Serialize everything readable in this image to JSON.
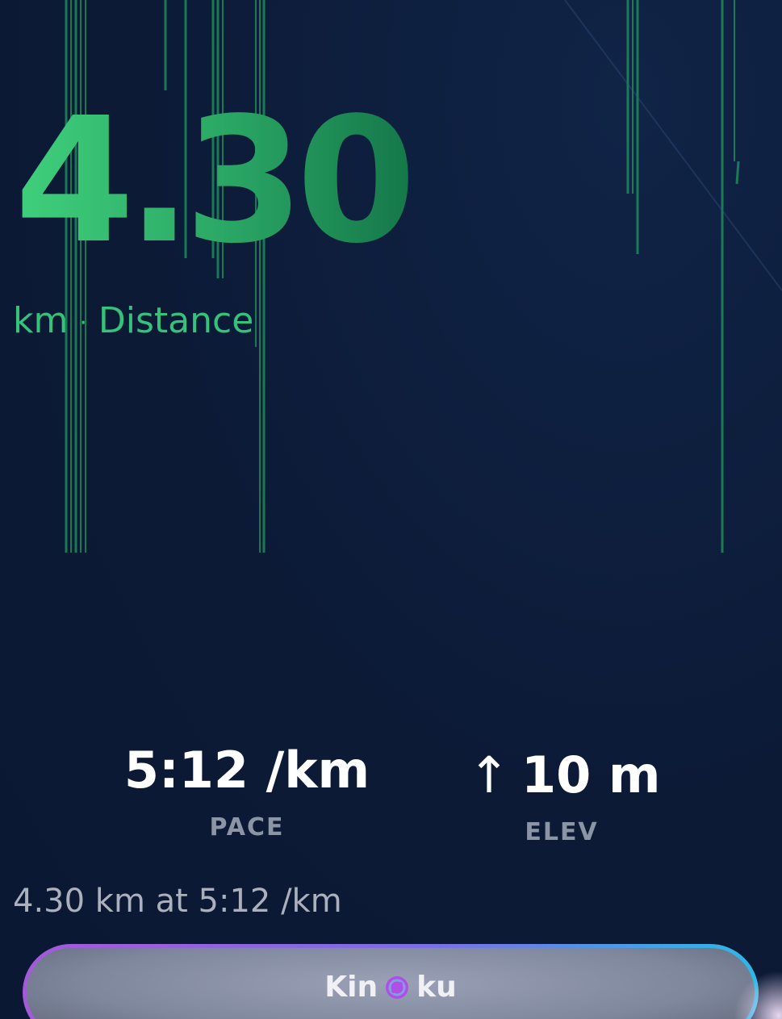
{
  "main": {
    "distance_value": "4.30",
    "distance_unit": "km",
    "distance_separator": "·",
    "distance_label": "Distance"
  },
  "stats": {
    "pace_value": "5:12 /km",
    "pace_label": "PACE",
    "elev_arrow": "↑",
    "elev_value": "10 m",
    "elev_label": "ELEV"
  },
  "summary_text": "4.30 km at 5:12 /km",
  "cta": {
    "text_before": "Kin",
    "text_after": "ku",
    "icon": "kinku-logo-icon"
  },
  "colors": {
    "background": "#0c1a36",
    "accent_green": "#35c27a",
    "button_gradient_start": "#a35ad8",
    "button_gradient_end": "#2cb8e6"
  }
}
